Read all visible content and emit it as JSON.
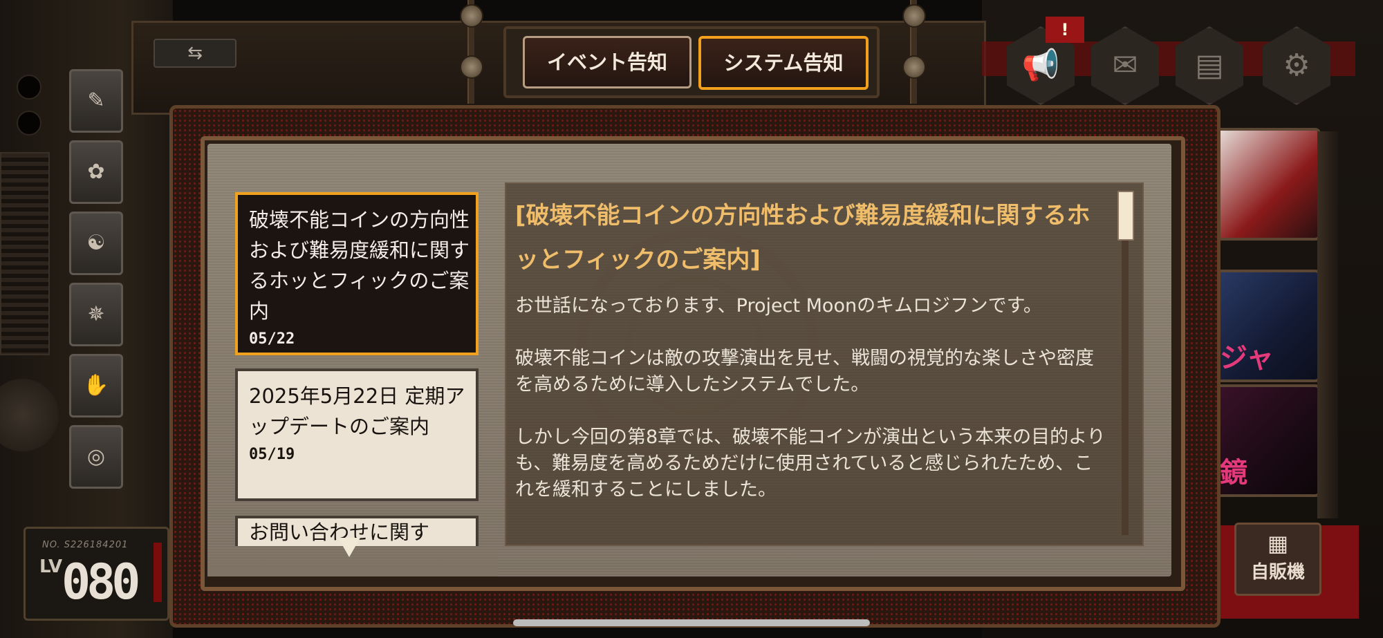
{
  "background": {
    "swap_symbol": "⇆",
    "player": {
      "number": "NO. S226184201",
      "level_label": "LV",
      "level_value": "080"
    },
    "side_icons": [
      "book-icon",
      "bird-emblem-icon",
      "dragon-icon",
      "sigil-icon",
      "hand-icon",
      "swirl-icon"
    ],
    "top_icons": [
      "megaphone-icon",
      "mail-icon",
      "box-icon",
      "gear-icon"
    ],
    "alert_badge": "!",
    "banner_cards": [
      {
        "label": ""
      },
      {
        "label": "ジャ"
      },
      {
        "label": "鏡"
      }
    ],
    "vending_label": "自販機"
  },
  "tabs": [
    {
      "label": "イベント告知",
      "active": false
    },
    {
      "label": "システム告知",
      "active": true
    }
  ],
  "notices": [
    {
      "title": "破壊不能コインの方向性および難易度緩和に関するホッとフィックのご案内",
      "date": "05/22",
      "selected": true
    },
    {
      "title": "2025年5月22日 定期アップデートのご案内",
      "date": "05/19",
      "selected": false
    },
    {
      "title": "お問い合わせに関す",
      "date": "",
      "selected": false
    }
  ],
  "detail": {
    "title": "[破壊不能コインの方向性および難易度緩和に関するホッとフィックのご案内]",
    "paragraphs": [
      "お世話になっております、Project Moonのキムロジフンです。",
      "破壊不能コインは敵の攻撃演出を見せ、戦闘の視覚的な楽しさや密度を高めるために導入したシステムでした。",
      "しかし今回の第8章では、破壊不能コインが演出という本来の目的よりも、難易度を高めるためだけに使用されていると感じられたため、これを緩和することにしました。"
    ]
  },
  "colors": {
    "accent_orange": "#f0a21f",
    "title_gold": "#f0bd6a",
    "alert_red": "#9a1616"
  }
}
